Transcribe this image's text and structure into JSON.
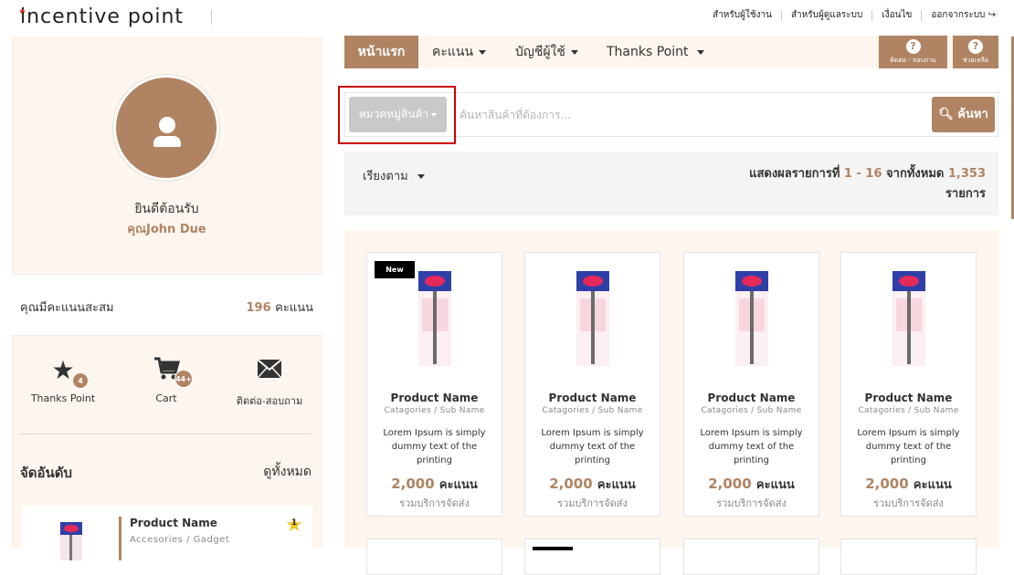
{
  "brand": {
    "logo_text": "incentive point",
    "accent": "#b08463",
    "accent_dark": "#9a6f50"
  },
  "top_links": [
    "สำหรับผู้ใช้งาน",
    "สำหรับผู้ดูแลระบบ",
    "เงื่อนไข",
    "ออกจากระบบ"
  ],
  "logout_icon": "logout-icon",
  "sidebar": {
    "avatar_icon": "user-icon",
    "welcome": "ยินดีต้อนรับ",
    "username": "คุณJohn Due",
    "points_label": "คุณมีคะแนนสะสม",
    "points_value": "196",
    "points_unit": "คะแนน",
    "shortcuts": [
      {
        "icon": "star-icon",
        "label": "Thanks Point",
        "badge": "4"
      },
      {
        "icon": "cart-icon",
        "label": "Cart",
        "badge": "44+"
      },
      {
        "icon": "mail-icon",
        "label": "ติดต่อ-สอบถาม",
        "badge": ""
      }
    ],
    "ranking": {
      "title": "จัดอันดับ",
      "view_all": "ดูทั้งหมด",
      "items": [
        {
          "name": "Product Name",
          "category": "Accesories / Gadget",
          "rank": "1"
        }
      ]
    }
  },
  "nav": {
    "items": [
      {
        "label": "หน้าแรก",
        "active": true,
        "dropdown": false
      },
      {
        "label": "คะแนน",
        "active": false,
        "dropdown": true
      },
      {
        "label": "บัญชีผู้ใช้",
        "active": false,
        "dropdown": true
      },
      {
        "label": "Thanks Point",
        "active": false,
        "dropdown": true
      }
    ],
    "help": [
      {
        "icon": "question-icon",
        "label": "ติดต่อ - สอบถาม"
      },
      {
        "icon": "question-icon",
        "label": "ช่วยเหลือ"
      }
    ]
  },
  "search": {
    "category_label": "หมวดหมู่สินค้า",
    "placeholder": "ค้นหาสินค้าที่ต้องการ...",
    "button_label": "ค้นหา"
  },
  "listing": {
    "sort_label": "เรียงตาม",
    "result_prefix": "แสดงผลรายการที่",
    "result_range": "1 - 16",
    "result_middle": "จากทั้งหมด",
    "result_total": "1,353",
    "result_suffix": "รายการ"
  },
  "products": [
    {
      "is_new": true,
      "badge": "New",
      "name": "Product Name",
      "category": "Catagories / Sub Name",
      "desc": "Lorem Ipsum is simply dummy text of the printing",
      "price": "2,000",
      "unit": "คะแนน",
      "shipping": "รวมบริการจัดส่ง"
    },
    {
      "is_new": false,
      "badge": "",
      "name": "Product Name",
      "category": "Catagories / Sub Name",
      "desc": "Lorem Ipsum is simply dummy text of the printing",
      "price": "2,000",
      "unit": "คะแนน",
      "shipping": "รวมบริการจัดส่ง"
    },
    {
      "is_new": false,
      "badge": "",
      "name": "Product Name",
      "category": "Catagories / Sub Name",
      "desc": "Lorem Ipsum is simply dummy text of the printing",
      "price": "2,000",
      "unit": "คะแนน",
      "shipping": "รวมบริการจัดส่ง"
    },
    {
      "is_new": false,
      "badge": "",
      "name": "Product Name",
      "category": "Catagories / Sub Name",
      "desc": "Lorem Ipsum is simply dummy text of the printing",
      "price": "2,000",
      "unit": "คะแนน",
      "shipping": "รวมบริการจัดส่ง"
    }
  ]
}
